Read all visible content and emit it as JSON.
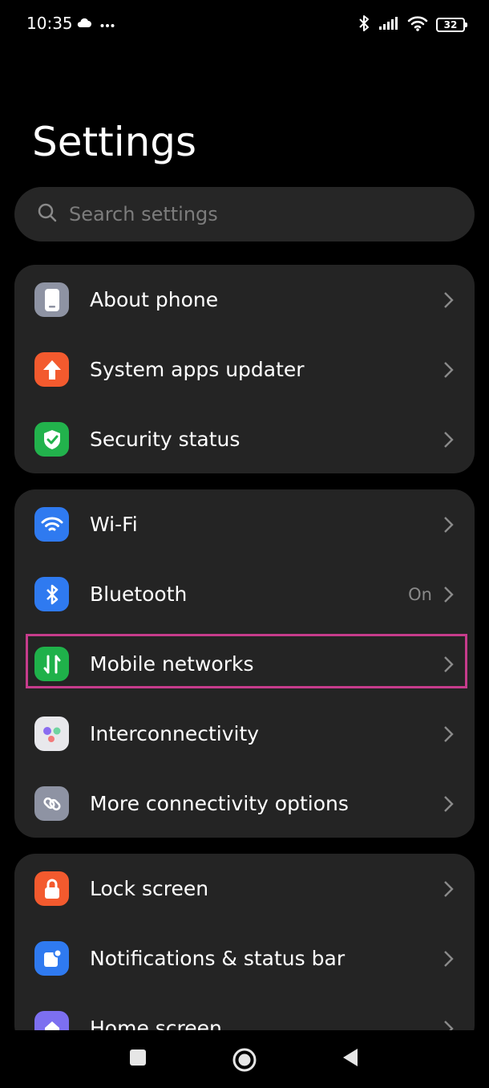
{
  "status_bar": {
    "time": "10:35",
    "left_icons": [
      "cloud-icon",
      "more-dots-icon"
    ],
    "right_icons": [
      "bluetooth-icon",
      "signal-icon",
      "wifi-icon",
      "battery-icon"
    ],
    "battery_level": "32"
  },
  "page": {
    "title": "Settings"
  },
  "search": {
    "placeholder": "Search settings"
  },
  "groups": [
    {
      "items": [
        {
          "label": "About phone",
          "icon": "phone-icon",
          "color": "#8e93a3"
        },
        {
          "label": "System apps updater",
          "icon": "arrow-up-icon",
          "color": "#f35a2e"
        },
        {
          "label": "Security status",
          "icon": "shield-icon",
          "color": "#22b24c"
        }
      ]
    },
    {
      "items": [
        {
          "label": "Wi-Fi",
          "icon": "wifi-icon",
          "color": "#2f7af0"
        },
        {
          "label": "Bluetooth",
          "icon": "bluetooth-icon",
          "color": "#2f7af0",
          "value": "On"
        },
        {
          "label": "Mobile networks",
          "icon": "mobile-data-icon",
          "color": "#1fb14a"
        },
        {
          "label": "Interconnectivity",
          "icon": "interconnectivity-icon",
          "color": "#e8e8ec"
        },
        {
          "label": "More connectivity options",
          "icon": "link-icon",
          "color": "#8e93a3"
        }
      ]
    },
    {
      "items": [
        {
          "label": "Lock screen",
          "icon": "lock-icon",
          "color": "#f35a2e"
        },
        {
          "label": "Notifications & status bar",
          "icon": "notification-icon",
          "color": "#2f7af0"
        },
        {
          "label": "Home screen",
          "icon": "home-icon",
          "color": "#7c6ff0"
        }
      ]
    }
  ],
  "highlight": {
    "target": "Mobile networks",
    "color": "#c63c8c"
  },
  "nav_bar": {
    "buttons": [
      "recents-button",
      "home-button",
      "back-button"
    ]
  }
}
